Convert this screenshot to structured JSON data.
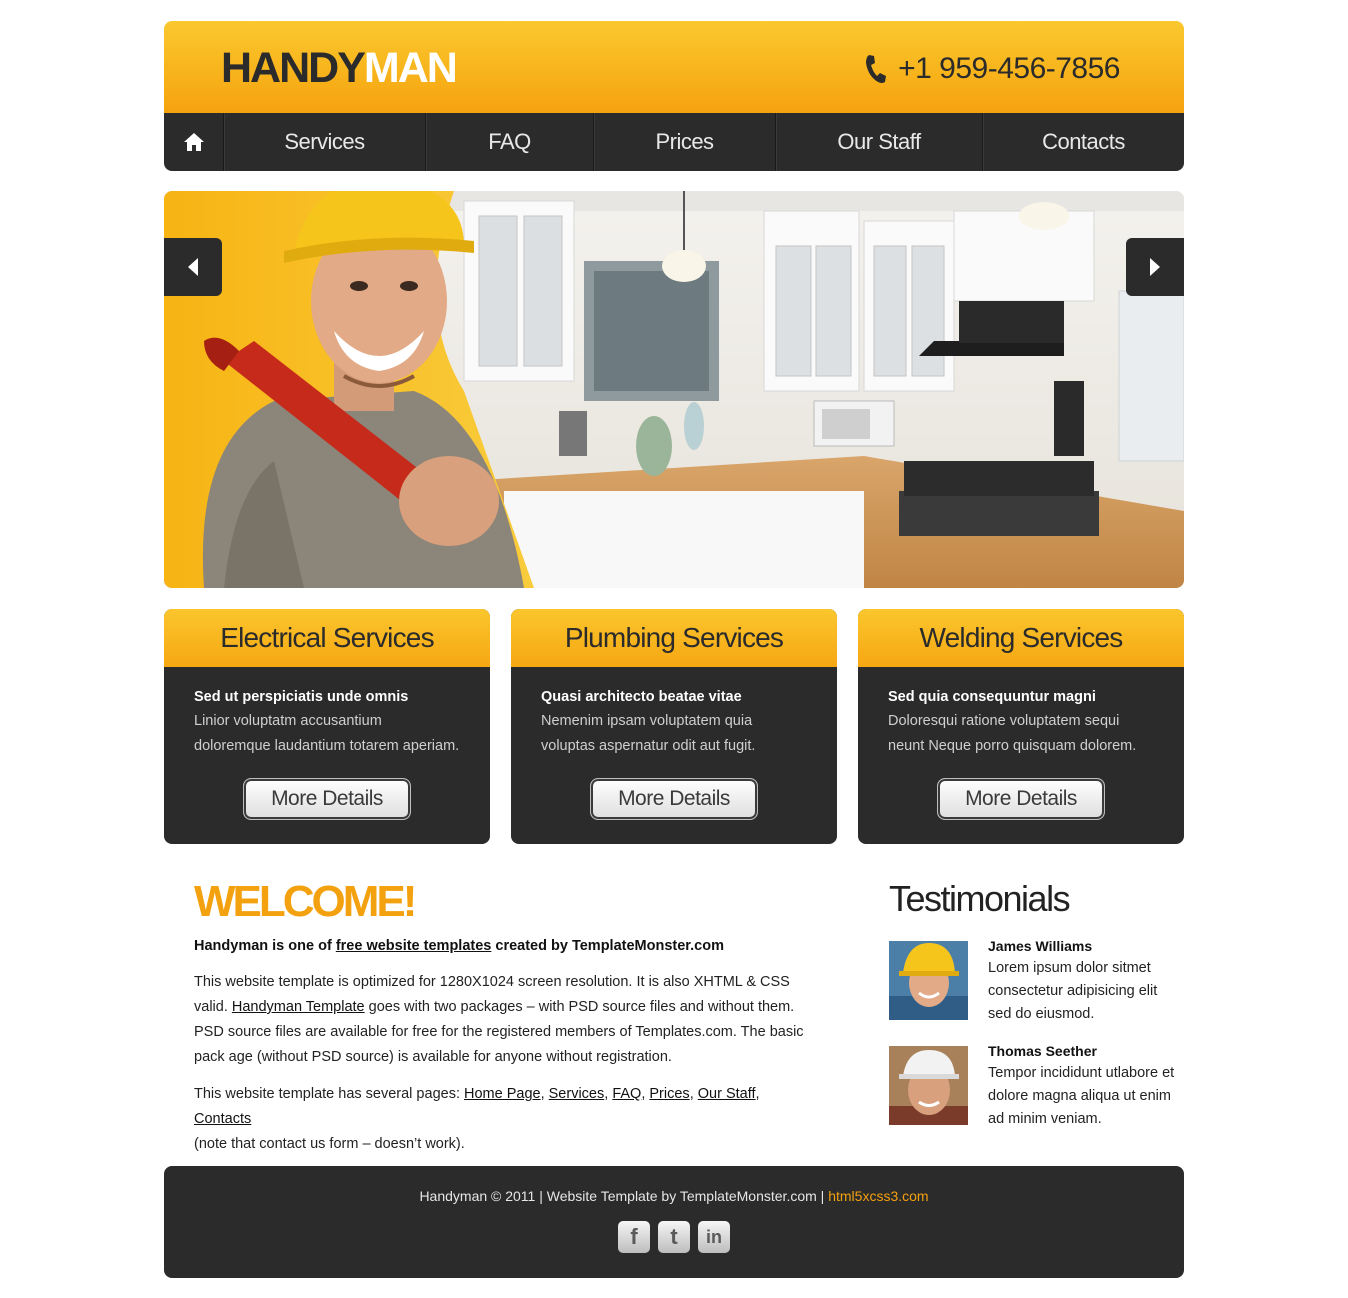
{
  "header": {
    "logo_part1": "HANDY",
    "logo_part2": "MAN",
    "phone": "+1 959-456-7856"
  },
  "nav": {
    "items": [
      "Services",
      "FAQ",
      "Prices",
      "Our Staff",
      "Contacts"
    ]
  },
  "services": [
    {
      "title": "Electrical Services",
      "subtitle": "Sed ut perspiciatis unde omnis",
      "text": "Linior voluptatm accusantium doloremque laudantium totarem aperiam.",
      "button": "More Details"
    },
    {
      "title": "Plumbing Services",
      "subtitle": "Quasi architecto beatae vitae",
      "text": "Nemenim ipsam voluptatem quia voluptas aspernatur odit aut fugit.",
      "button": "More Details"
    },
    {
      "title": "Welding Services",
      "subtitle": "Sed quia consequuntur magni",
      "text": "Doloresqui ratione voluptatem sequi neunt Neque porro quisquam dolorem.",
      "button": "More Details"
    }
  ],
  "welcome": {
    "heading": "WELCOME!",
    "lead_before": "Handyman is one of ",
    "lead_link": "free website templates",
    "lead_after": " created by TemplateMonster.com",
    "p1_before": "This website template is optimized for 1280X1024 screen resolution. It is also XHTML & CSS valid. ",
    "p1_link": "Handyman Template",
    "p1_after": " goes with two packages – with PSD source files and without them. PSD source files are available for free for the registered members of Templates.com. The basic pack age (without PSD source) is available for anyone without registration.",
    "p2_before": "This website template has several pages: ",
    "p2_links": [
      "Home Page",
      "Services",
      "FAQ",
      "Prices",
      "Our Staff",
      "Contacts"
    ],
    "p2_after": "(note that contact us form – doesn’t work)."
  },
  "testimonials": {
    "heading": "Testimonials",
    "items": [
      {
        "name": "James Williams",
        "text": "Lorem ipsum dolor sitmet consectetur adipisicing elit sed do eiusmod."
      },
      {
        "name": "Thomas Seether",
        "text": "Tempor incididunt utlabore et dolore magna aliqua ut enim ad minim veniam."
      }
    ]
  },
  "footer": {
    "text": "Handyman © 2011 | Website Template by TemplateMonster.com | ",
    "link": "html5xcss3.com",
    "socials": [
      "f",
      "t",
      "in"
    ]
  },
  "colors": {
    "accent": "#f4a10f",
    "dark": "#2b2b2b"
  }
}
